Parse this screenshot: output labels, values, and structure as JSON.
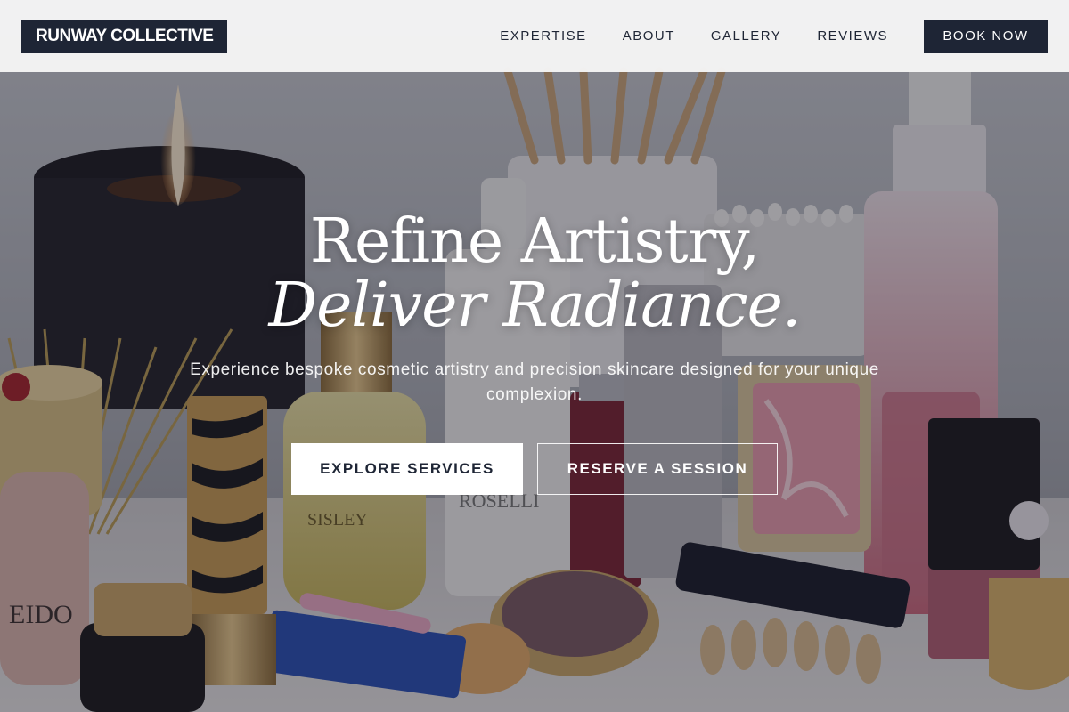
{
  "brand": {
    "name": "RUNWAY COLLECTIVE"
  },
  "nav": {
    "items": [
      {
        "label": "EXPERTISE"
      },
      {
        "label": "ABOUT"
      },
      {
        "label": "GALLERY"
      },
      {
        "label": "REVIEWS"
      }
    ],
    "book_label": "BOOK NOW"
  },
  "hero": {
    "headline_line1": "Refine Artistry,",
    "headline_line2": "Deliver Radiance.",
    "subtext": "Experience bespoke cosmetic artistry and precision skincare designed for your unique complexion.",
    "primary_cta": "EXPLORE SERVICES",
    "secondary_cta": "RESERVE A SESSION",
    "background_image": "cosmetics-table-photo"
  },
  "colors": {
    "navy": "#1e2535",
    "white": "#ffffff",
    "header_bg": "#f6f6f6"
  }
}
